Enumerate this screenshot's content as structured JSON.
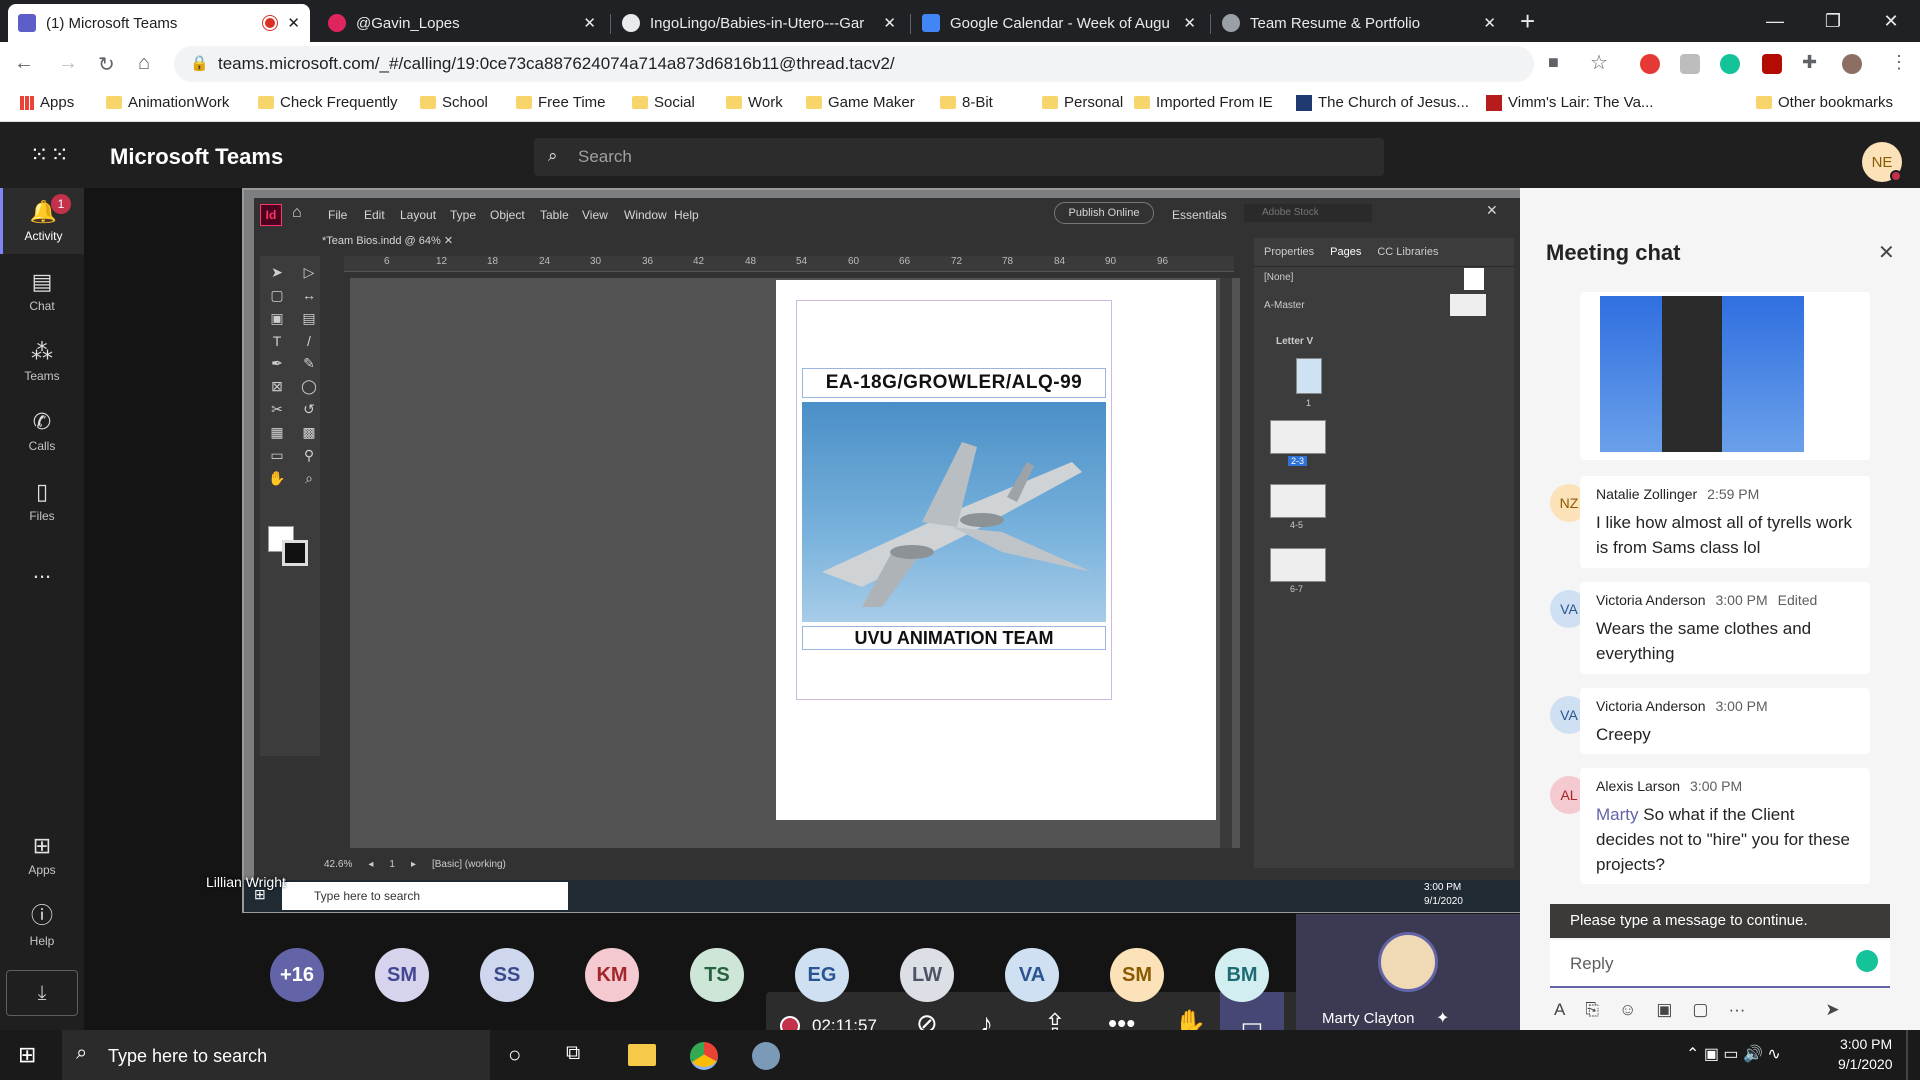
{
  "browser": {
    "tabs": [
      {
        "title": "(1) Microsoft Teams",
        "active": true
      },
      {
        "title": "@Gavin_Lopes"
      },
      {
        "title": "IngoLingo/Babies-in-Utero---Gar"
      },
      {
        "title": "Google Calendar - Week of Augu"
      },
      {
        "title": "Team Resume & Portfolio"
      }
    ],
    "url": "teams.microsoft.com/_#/calling/19:0ce73ca887624074a714a873d6816b11@thread.tacv2/",
    "bookmarks": [
      "Apps",
      "AnimationWork",
      "Check Frequently",
      "School",
      "Free Time",
      "Social",
      "Work",
      "Game Maker",
      "8-Bit",
      "Personal",
      "Imported From IE",
      "The Church of Jesus...",
      "Vimm's Lair: The Va...",
      "Other bookmarks"
    ]
  },
  "teams": {
    "app_title": "Microsoft Teams",
    "search_placeholder": "Search",
    "user_initials": "NE",
    "rail": [
      {
        "label": "Activity",
        "icon": "bell-icon",
        "badge": "1"
      },
      {
        "label": "Chat",
        "icon": "chat-icon"
      },
      {
        "label": "Teams",
        "icon": "teams-icon"
      },
      {
        "label": "Calls",
        "icon": "phone-icon"
      },
      {
        "label": "Files",
        "icon": "files-icon"
      },
      {
        "label": "...",
        "icon": "more-icon"
      },
      {
        "label": "Apps",
        "icon": "apps-icon"
      },
      {
        "label": "Help",
        "icon": "help-icon"
      }
    ]
  },
  "shared_screen": {
    "presenter_label": "Lillian Wright",
    "indesign": {
      "menus": [
        "File",
        "Edit",
        "Layout",
        "Type",
        "Object",
        "Table",
        "View",
        "Window",
        "Help"
      ],
      "publish_label": "Publish Online",
      "workspace": "Essentials",
      "stock_search": "Adobe Stock",
      "doc_tab": "*Team Bios.indd @ 64%",
      "ruler_ticks": [
        "6",
        "12",
        "18",
        "24",
        "30",
        "36",
        "42",
        "48",
        "54",
        "60",
        "66",
        "72",
        "78",
        "84",
        "90",
        "96"
      ],
      "page_title": "EA-18G/GROWLER/ALQ-99",
      "page_footer": "UVU ANIMATION TEAM",
      "panel_tabs": [
        "Properties",
        "Pages",
        "CC Libraries"
      ],
      "masters": [
        "[None]",
        "A-Master"
      ],
      "page_size": "Letter V",
      "spreads": [
        "1",
        "2-3",
        "4-5",
        "6-7"
      ],
      "zoom": "42.6%",
      "page_num": "1",
      "status": "[Basic] (working)"
    },
    "remote_taskbar": {
      "search": "Type here to search",
      "time": "3:00 PM",
      "date": "9/1/2020"
    }
  },
  "call": {
    "timer": "02:11:57"
  },
  "participants": [
    {
      "initials": "+16",
      "bg": "#6264a7",
      "fg": "#ffffff"
    },
    {
      "initials": "SM",
      "bg": "#d6d4ec",
      "fg": "#444791"
    },
    {
      "initials": "SS",
      "bg": "#cfd7ef",
      "fg": "#3b4a8c"
    },
    {
      "initials": "KM",
      "bg": "#f4c9cf",
      "fg": "#a4262c"
    },
    {
      "initials": "TS",
      "bg": "#cde6d8",
      "fg": "#286340"
    },
    {
      "initials": "EG",
      "bg": "#cfe0f3",
      "fg": "#2a5591"
    },
    {
      "initials": "LW",
      "bg": "#dcdfe6",
      "fg": "#4f5366"
    },
    {
      "initials": "VA",
      "bg": "#cfe0f3",
      "fg": "#2a5591"
    },
    {
      "initials": "SM",
      "bg": "#fce2b8",
      "fg": "#8a5a00"
    },
    {
      "initials": "BM",
      "bg": "#d3eef0",
      "fg": "#1d6b73"
    }
  ],
  "self_view": {
    "name": "Marty Clayton"
  },
  "chat": {
    "title": "Meeting chat",
    "messages": [
      {
        "initials": "NZ",
        "name": "Natalie Zollinger",
        "time": "2:59 PM",
        "edited": "",
        "text": "I like how almost all of tyrells work is from Sams class lol",
        "mention": ""
      },
      {
        "initials": "VA",
        "name": "Victoria Anderson",
        "time": "3:00 PM",
        "edited": "Edited",
        "text": "Wears the same clothes and everything",
        "mention": ""
      },
      {
        "initials": "VA",
        "name": "Victoria Anderson",
        "time": "3:00 PM",
        "edited": "",
        "text": "Creepy",
        "mention": ""
      },
      {
        "initials": "AL",
        "name": "Alexis Larson",
        "time": "3:00 PM",
        "edited": "",
        "text": "So what if the Client decides not to \"hire\" you for these projects?",
        "mention": "Marty"
      }
    ],
    "warning": "Please type a message to continue.",
    "reply_placeholder": "Reply"
  },
  "taskbar": {
    "search": "Type here to search",
    "time": "3:00 PM",
    "date": "9/1/2020"
  }
}
